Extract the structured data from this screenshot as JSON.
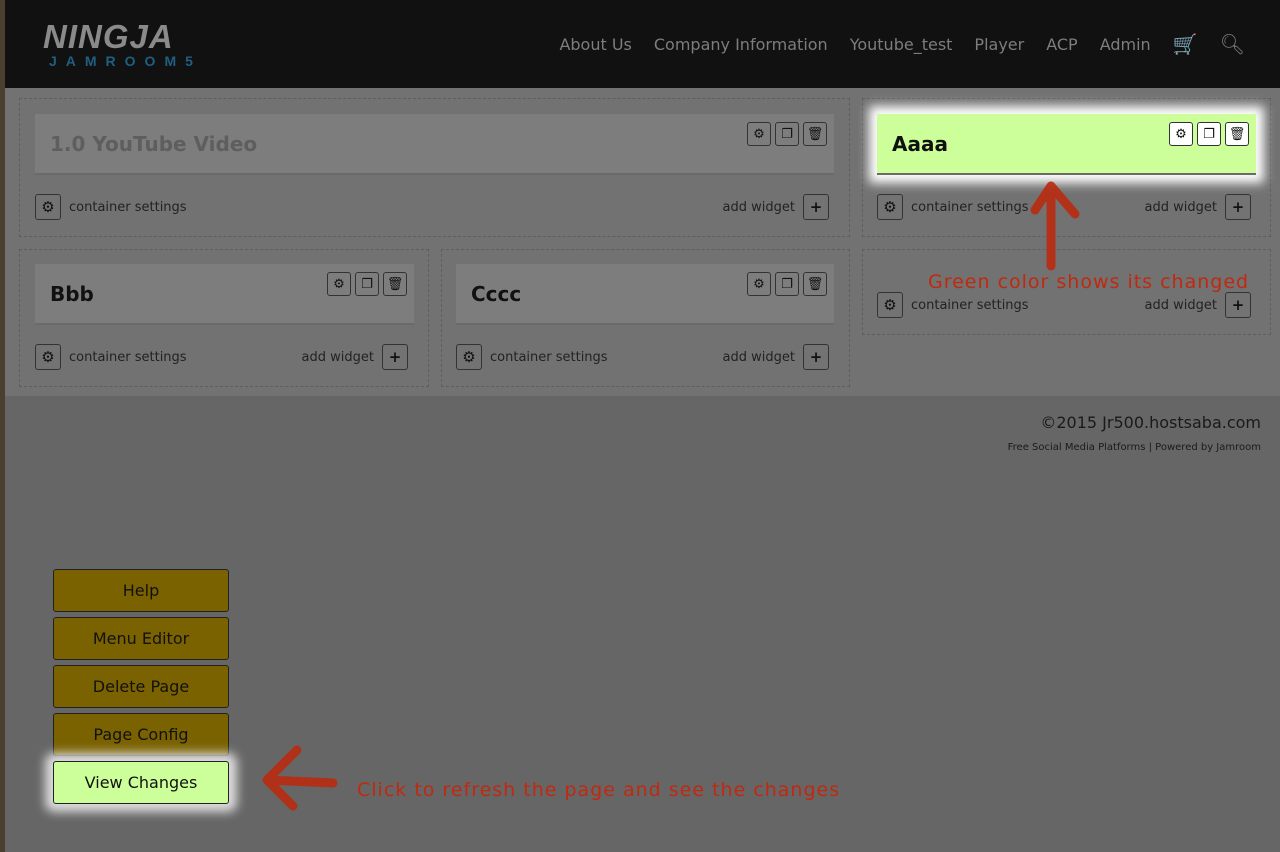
{
  "header": {
    "logo_top": "NINGJA",
    "logo_bottom": "JAMROOM5",
    "nav": [
      "About Us",
      "Company Information",
      "Youtube_test",
      "Player",
      "ACP",
      "Admin"
    ],
    "cart_icon": "cart-icon",
    "search_icon": "search-icon"
  },
  "containers": [
    {
      "widget": "1.0 YouTube Video",
      "settings": "container settings",
      "add": "add widget"
    },
    {
      "widget": "Aaaa",
      "settings": "container settings",
      "add": "add widget"
    },
    {
      "widget": "Bbb",
      "settings": "container settings",
      "add": "add widget"
    },
    {
      "widget": "Cccc",
      "settings": "container settings",
      "add": "add widget"
    },
    {
      "settings": "container settings",
      "add": "add widget"
    }
  ],
  "footer": {
    "copyright": "©2015 Jr500.hostsaba.com",
    "links": "Free Social Media Platforms | Powered by Jamroom"
  },
  "buttons": [
    "Help",
    "Menu Editor",
    "Delete Page",
    "Page Config",
    "View Changes"
  ],
  "annotations": {
    "top": "Green color shows its changed",
    "bottom": "Click to refresh the page and see the changes"
  },
  "colors": {
    "changed": "#ccff99",
    "annotation": "#c0290f",
    "button": "#7a6200"
  }
}
